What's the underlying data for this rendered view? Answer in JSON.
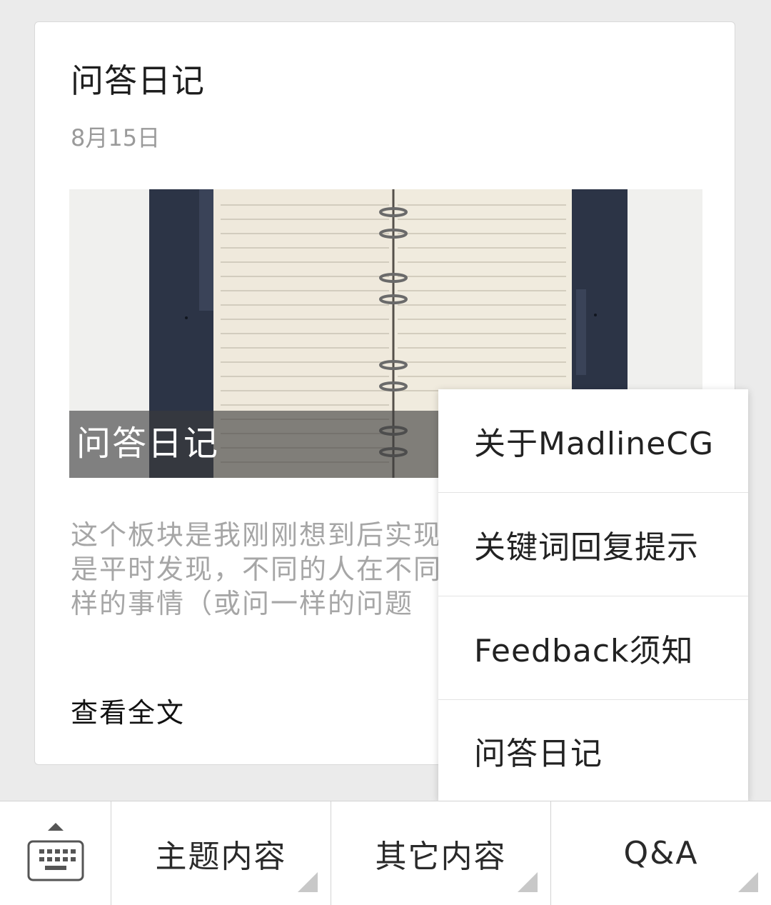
{
  "article": {
    "title": "问答日记",
    "date": "8月15日",
    "cover_caption": "问答日记",
    "excerpt_lines": [
      "这个板块是我刚刚想到后实现",
      "是平时发现，不同的人在不同",
      "样的事情（或问一样的问题"
    ],
    "read_more": "查看全文"
  },
  "popup_menu": {
    "items": [
      {
        "label": "关于MadlineCG"
      },
      {
        "label": "关键词回复提示"
      },
      {
        "label": "Feedback须知"
      },
      {
        "label": "问答日记"
      }
    ]
  },
  "bottom_menu": {
    "keyboard_icon": "keyboard-icon",
    "items": [
      {
        "label": "主题内容"
      },
      {
        "label": "其它内容"
      },
      {
        "label": "Q&A"
      }
    ]
  },
  "colors": {
    "background": "#ebebeb",
    "card": "#ffffff",
    "date_text": "#9a9a9a",
    "excerpt_text": "#a6a6a6",
    "notebook_cover": "#2c3446",
    "paper": "#efe9dc"
  }
}
